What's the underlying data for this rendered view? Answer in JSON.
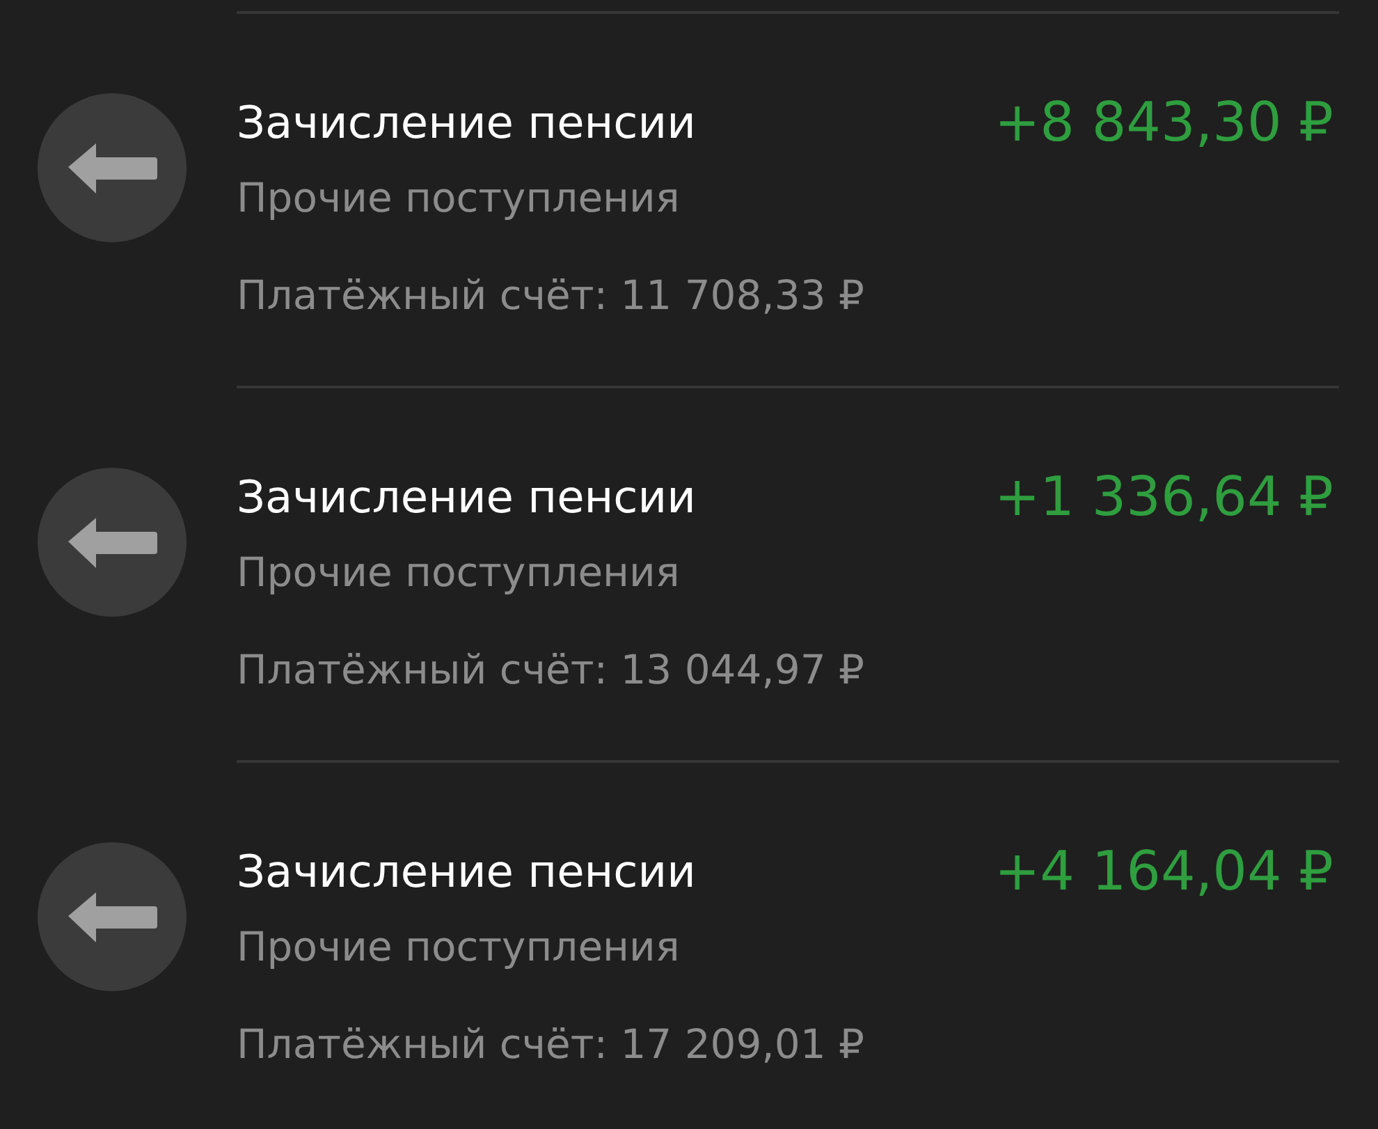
{
  "transactions": [
    {
      "title": "Зачисление пенсии",
      "amount": "+8 843,30 ₽",
      "category": "Прочие поступления",
      "account": "Платёжный счёт: 11 708,33 ₽"
    },
    {
      "title": "Зачисление пенсии",
      "amount": "+1 336,64 ₽",
      "category": "Прочие поступления",
      "account": "Платёжный счёт: 13 044,97 ₽"
    },
    {
      "title": "Зачисление пенсии",
      "amount": "+4 164,04 ₽",
      "category": "Прочие поступления",
      "account": "Платёжный счёт: 17 209,01 ₽"
    }
  ]
}
